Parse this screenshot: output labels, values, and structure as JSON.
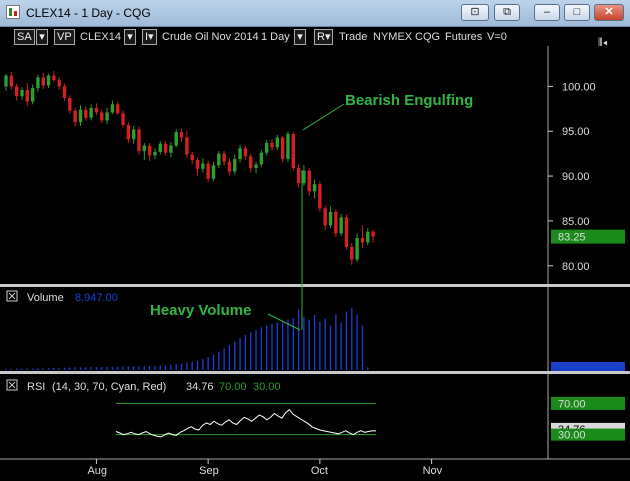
{
  "window": {
    "title": "CLEX14 - 1 Day - CQG",
    "buttons": {
      "restore_pin": "⊡",
      "tile": "⧉",
      "minimize": "–",
      "maximize": "□",
      "close": "✕"
    }
  },
  "toolbar": {
    "sa": "SA",
    "vp": "VP",
    "symbol": "CLEX14",
    "dropdown_glyph": "▾",
    "i_box": "I▾",
    "description": "Crude Oil Nov 2014",
    "period": "1 Day",
    "r_box": "R▾",
    "mode": "Trade",
    "exchange": "NYMEX",
    "vendor": "CQG",
    "type": "Futures",
    "v": "V=0",
    "right_icon": "⫴◂"
  },
  "colors": {
    "up": "#2e9e2e",
    "down": "#d42020",
    "volume": "#1f3fd8",
    "rsi_line": "#ffffff",
    "annotation": "#33b545",
    "price_tag": "#1a8a1a",
    "separator": "#c8c8c8"
  },
  "chart_data": [
    {
      "type": "candlestick",
      "symbol": "CLEX14",
      "yticks": [
        "100.00",
        "95.00",
        "90.00",
        "85.00",
        "80.00"
      ],
      "ylim": [
        78.3,
        103.5
      ],
      "last_price_label": "83.25",
      "annotation": "Bearish Engulfing",
      "xticks": [
        "Aug",
        "Sep",
        "Oct",
        "Nov"
      ],
      "ohlc": [
        [
          100,
          101.4,
          99.5,
          101.2
        ],
        [
          101.2,
          101.6,
          99.6,
          100.0
        ],
        [
          100,
          100.3,
          98.4,
          98.9
        ],
        [
          98.9,
          99.9,
          98.5,
          99.6
        ],
        [
          99.6,
          100.4,
          97.8,
          98.3
        ],
        [
          98.3,
          100.2,
          98.0,
          99.8
        ],
        [
          99.8,
          101.3,
          99.4,
          101.0
        ],
        [
          101.0,
          101.5,
          99.7,
          100.1
        ],
        [
          100.1,
          101.4,
          99.8,
          101.2
        ],
        [
          101.2,
          101.7,
          100.5,
          100.7
        ],
        [
          100.7,
          101.0,
          99.6,
          100.0
        ],
        [
          100.0,
          100.3,
          98.4,
          98.7
        ],
        [
          98.7,
          99.0,
          97.0,
          97.3
        ],
        [
          97.3,
          97.6,
          95.5,
          96.0
        ],
        [
          96.0,
          97.9,
          95.6,
          97.4
        ],
        [
          97.4,
          97.8,
          96.2,
          96.5
        ],
        [
          96.5,
          98.0,
          96.2,
          97.6
        ],
        [
          97.6,
          98.1,
          96.8,
          97.1
        ],
        [
          97.1,
          97.4,
          95.9,
          96.2
        ],
        [
          96.2,
          97.6,
          95.8,
          97.1
        ],
        [
          97.1,
          98.4,
          96.9,
          98.0
        ],
        [
          98.0,
          98.3,
          96.8,
          97.0
        ],
        [
          97.0,
          97.3,
          95.4,
          95.7
        ],
        [
          95.7,
          96.0,
          93.7,
          94.1
        ],
        [
          94.1,
          95.6,
          93.6,
          95.2
        ],
        [
          95.2,
          95.5,
          92.4,
          92.8
        ],
        [
          92.8,
          93.7,
          91.8,
          93.4
        ],
        [
          93.4,
          93.7,
          91.7,
          92.3
        ],
        [
          92.3,
          93.1,
          91.9,
          92.7
        ],
        [
          92.7,
          93.9,
          92.4,
          93.6
        ],
        [
          93.6,
          93.9,
          92.3,
          92.6
        ],
        [
          92.6,
          93.8,
          92.1,
          93.4
        ],
        [
          93.4,
          95.2,
          93.2,
          94.9
        ],
        [
          94.9,
          95.3,
          93.8,
          94.3
        ],
        [
          94.3,
          95.0,
          92.0,
          92.4
        ],
        [
          92.4,
          92.7,
          91.3,
          91.8
        ],
        [
          91.8,
          92.1,
          90.0,
          90.8
        ],
        [
          90.8,
          92.0,
          90.4,
          91.4
        ],
        [
          91.4,
          91.7,
          89.3,
          89.7
        ],
        [
          89.7,
          91.6,
          89.4,
          91.2
        ],
        [
          91.2,
          92.8,
          90.9,
          92.5
        ],
        [
          92.5,
          92.8,
          91.2,
          91.6
        ],
        [
          91.6,
          92.0,
          90.1,
          90.5
        ],
        [
          90.5,
          92.4,
          90.2,
          91.9
        ],
        [
          91.9,
          93.5,
          91.5,
          93.1
        ],
        [
          93.1,
          93.4,
          91.8,
          92.2
        ],
        [
          92.2,
          92.5,
          90.4,
          90.9
        ],
        [
          90.9,
          91.6,
          90.3,
          91.3
        ],
        [
          91.3,
          92.9,
          91.0,
          92.6
        ],
        [
          92.6,
          94.0,
          92.3,
          93.7
        ],
        [
          93.7,
          94.1,
          92.8,
          93.2
        ],
        [
          93.2,
          94.6,
          92.9,
          94.3
        ],
        [
          94.3,
          94.5,
          91.5,
          91.9
        ],
        [
          91.9,
          95.0,
          91.6,
          94.7
        ],
        [
          94.7,
          94.9,
          90.6,
          90.9
        ],
        [
          90.9,
          91.3,
          88.7,
          89.2
        ],
        [
          89.2,
          91.2,
          88.9,
          90.6
        ],
        [
          90.6,
          90.9,
          87.8,
          88.3
        ],
        [
          88.3,
          89.6,
          87.5,
          89.1
        ],
        [
          89.1,
          89.4,
          86.0,
          86.4
        ],
        [
          86.4,
          86.7,
          84.0,
          84.5
        ],
        [
          84.5,
          86.6,
          84.2,
          86.0
        ],
        [
          86.0,
          86.3,
          83.2,
          83.6
        ],
        [
          83.6,
          85.8,
          83.3,
          85.4
        ],
        [
          85.4,
          85.7,
          81.8,
          82.1
        ],
        [
          82.1,
          82.5,
          80.1,
          80.7
        ],
        [
          80.7,
          83.6,
          80.4,
          83.1
        ],
        [
          83.1,
          84.5,
          82.0,
          82.6
        ],
        [
          82.6,
          84.2,
          82.3,
          83.8
        ],
        [
          83.8,
          84.0,
          82.6,
          83.25
        ]
      ]
    },
    {
      "type": "bar",
      "title": "Volume",
      "readout": "8,947.00",
      "annotation": "Heavy Volume",
      "ylim": [
        0,
        250000
      ],
      "values": [
        4000,
        4000,
        5000,
        5000,
        5000,
        5000,
        6000,
        6000,
        6000,
        7000,
        7000,
        8000,
        8000,
        9000,
        9000,
        9000,
        10000,
        10000,
        10000,
        11000,
        11000,
        11000,
        12000,
        12000,
        12000,
        13000,
        13000,
        14000,
        14000,
        15000,
        16000,
        18000,
        20000,
        22000,
        25000,
        28000,
        32000,
        37000,
        44000,
        52000,
        62000,
        72000,
        84000,
        96000,
        108000,
        118000,
        128000,
        136000,
        144000,
        150000,
        156000,
        160000,
        165000,
        170000,
        175000,
        205000,
        180000,
        170000,
        186000,
        164000,
        174000,
        150000,
        188000,
        160000,
        198000,
        210000,
        188000,
        150000,
        8947,
        0
      ]
    },
    {
      "type": "line",
      "title": "RSI",
      "params": "(14, 30, 70, Cyan, Red)",
      "readout_value": "34.76",
      "readout_upper": "70.00",
      "readout_lower": "30.00",
      "upper": 70,
      "lower": 30,
      "ylim": [
        0,
        100
      ],
      "tag_upper": "70.00",
      "tag_lower": "30.00",
      "tag_value": "34.76",
      "values": [
        34,
        32,
        30,
        31,
        33,
        31,
        30,
        32,
        34,
        31,
        29,
        28,
        27,
        30,
        32,
        30,
        29,
        33,
        35,
        38,
        40,
        37,
        36,
        42,
        45,
        43,
        47,
        44,
        42,
        46,
        49,
        45,
        43,
        48,
        52,
        50,
        47,
        51,
        55,
        53,
        49,
        52,
        57,
        54,
        51,
        58,
        62,
        56,
        53,
        50,
        47,
        44,
        40,
        38,
        36,
        35,
        34,
        33,
        32,
        31,
        33,
        35,
        32,
        30,
        33,
        35,
        33,
        34,
        35,
        34.76
      ]
    }
  ]
}
